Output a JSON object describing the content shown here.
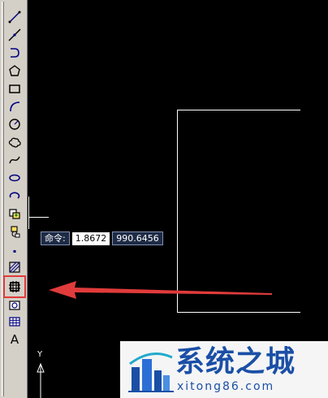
{
  "toolbar": {
    "tools": [
      {
        "name": "line-tool",
        "icon": "line-icon"
      },
      {
        "name": "construction-line-tool",
        "icon": "construction-line-icon"
      },
      {
        "name": "polyline-tool",
        "icon": "polyline-icon"
      },
      {
        "name": "polygon-tool",
        "icon": "polygon-icon"
      },
      {
        "name": "rectangle-tool",
        "icon": "rectangle-icon"
      },
      {
        "name": "arc-tool",
        "icon": "arc-icon"
      },
      {
        "name": "circle-tool",
        "icon": "circle-icon"
      },
      {
        "name": "revision-cloud-tool",
        "icon": "revision-cloud-icon"
      },
      {
        "name": "spline-tool",
        "icon": "spline-icon"
      },
      {
        "name": "ellipse-tool",
        "icon": "ellipse-icon"
      },
      {
        "name": "ellipse-arc-tool",
        "icon": "ellipse-arc-icon"
      },
      {
        "name": "insert-block-tool",
        "icon": "insert-block-icon"
      },
      {
        "name": "make-block-tool",
        "icon": "make-block-icon"
      },
      {
        "name": "point-tool",
        "icon": "point-icon"
      },
      {
        "name": "hatch-tool",
        "icon": "hatch-icon"
      },
      {
        "name": "gradient-tool",
        "icon": "gradient-icon"
      },
      {
        "name": "region-tool",
        "icon": "region-icon"
      },
      {
        "name": "table-tool",
        "icon": "table-icon"
      },
      {
        "name": "multiline-text-tool",
        "icon": "text-icon",
        "glyph": "A"
      }
    ]
  },
  "dynamic_input": {
    "label": "命令:",
    "x_value": "1.8672",
    "y_value": "990.6456"
  },
  "ucs": {
    "axis_label": "Y"
  },
  "watermark": {
    "title": "系统之城",
    "url": "xitong86.com"
  },
  "colors": {
    "canvas": "#000000",
    "toolbar": "#d4d0c8",
    "highlight": "#e13b3b",
    "watermark_blue": "#1a4fa6"
  }
}
